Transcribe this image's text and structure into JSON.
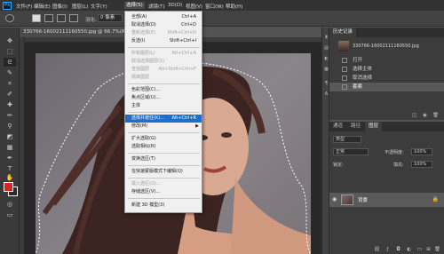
{
  "app": {
    "logo_text": "Ps"
  },
  "menubar": {
    "items": [
      "文件(F)",
      "编辑(E)",
      "图像(I)",
      "图层(L)",
      "文字(Y)",
      "选择(S)",
      "滤镜(T)",
      "3D(D)",
      "视图(V)",
      "窗口(W)",
      "帮助(H)"
    ],
    "active_index": 5
  },
  "options_bar": {
    "feather_label": "羽化:",
    "feather_value": "0 像素"
  },
  "document": {
    "tab_title": "330766-16002111160550.jpg @ 66.7%(RGB/8)"
  },
  "select_menu": {
    "items": [
      {
        "label": "全部(A)",
        "shortcut": "Ctrl+A",
        "disabled": false
      },
      {
        "label": "取消选择(D)",
        "shortcut": "Ctrl+D",
        "disabled": false
      },
      {
        "label": "重新选择(E)",
        "shortcut": "Shift+Ctrl+D",
        "disabled": true
      },
      {
        "label": "反选(I)",
        "shortcut": "Shift+Ctrl+I",
        "disabled": false
      },
      {
        "label": "所有图层(L)",
        "shortcut": "Alt+Ctrl+A",
        "disabled": true
      },
      {
        "label": "取消选择图层(S)",
        "shortcut": "",
        "disabled": true
      },
      {
        "label": "查找图层",
        "shortcut": "Alt+Shift+Ctrl+F",
        "disabled": true
      },
      {
        "label": "隔离图层",
        "shortcut": "",
        "disabled": true
      },
      {
        "label": "色彩范围(C)...",
        "shortcut": "",
        "disabled": false
      },
      {
        "label": "焦点区域(U)...",
        "shortcut": "",
        "disabled": false
      },
      {
        "label": "主体",
        "shortcut": "",
        "disabled": false
      },
      {
        "label": "选择并遮住(K)...",
        "shortcut": "Alt+Ctrl+R",
        "disabled": false,
        "highlight": true
      },
      {
        "label": "修改(M)",
        "shortcut": "",
        "disabled": false,
        "submenu": true
      },
      {
        "label": "扩大选取(G)",
        "shortcut": "",
        "disabled": false
      },
      {
        "label": "选取相似(R)",
        "shortcut": "",
        "disabled": false
      },
      {
        "label": "变换选区(T)",
        "shortcut": "",
        "disabled": false
      },
      {
        "label": "在快速蒙版模式下编辑(Q)",
        "shortcut": "",
        "disabled": false
      },
      {
        "label": "载入选区(O)...",
        "shortcut": "",
        "disabled": true
      },
      {
        "label": "存储选区(V)...",
        "shortcut": "",
        "disabled": false
      },
      {
        "label": "新建 3D 模型(3)",
        "shortcut": "",
        "disabled": false
      }
    ]
  },
  "history_panel": {
    "tab_label": "历史记录",
    "snapshot_name": "330766-16002111160550.jpg",
    "items": [
      "打开",
      "选择主体",
      "取消选择",
      "套索"
    ],
    "selected_index": 3
  },
  "layers_panel": {
    "tabs": [
      "通道",
      "路径",
      "图层"
    ],
    "active_tab": 2,
    "kind_filter": "类型",
    "blend_mode": "正常",
    "opacity_label": "不透明度:",
    "opacity_value": "100%",
    "lock_label": "锁定:",
    "fill_label": "填充:",
    "fill_value": "100%",
    "layer_name": "背景"
  }
}
